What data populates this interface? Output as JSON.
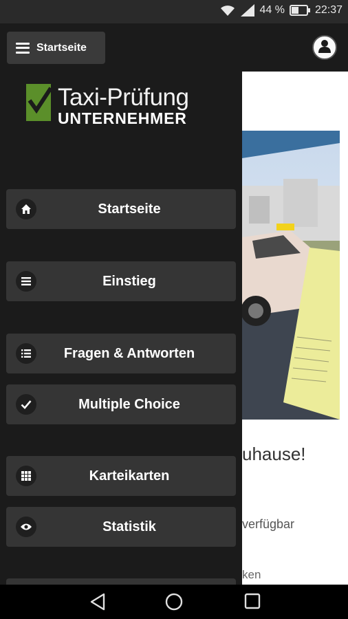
{
  "status_bar": {
    "battery_percent": "44 %",
    "time": "22:37"
  },
  "app_bar": {
    "menu_label": "Startseite"
  },
  "logo": {
    "title": "Taxi-Prüfung",
    "subtitle": "UNTERNEHMER"
  },
  "nav": {
    "items": [
      {
        "label": "Startseite",
        "icon": "home-icon"
      },
      {
        "label": "Einstieg",
        "icon": "menu-lines-icon"
      },
      {
        "label": "Fragen & Antworten",
        "icon": "list-icon"
      },
      {
        "label": "Multiple Choice",
        "icon": "check-icon"
      },
      {
        "label": "Karteikarten",
        "icon": "grid-icon"
      },
      {
        "label": "Statistik",
        "icon": "eye-icon"
      }
    ]
  },
  "background_page": {
    "headline_fragment": "uhause!",
    "line2_fragment": "verfügbar",
    "line3_fragment": "ken"
  },
  "colors": {
    "drawer_bg": "#1b1b1b",
    "button_bg": "#353535",
    "logo_green": "#5b8f2a"
  }
}
